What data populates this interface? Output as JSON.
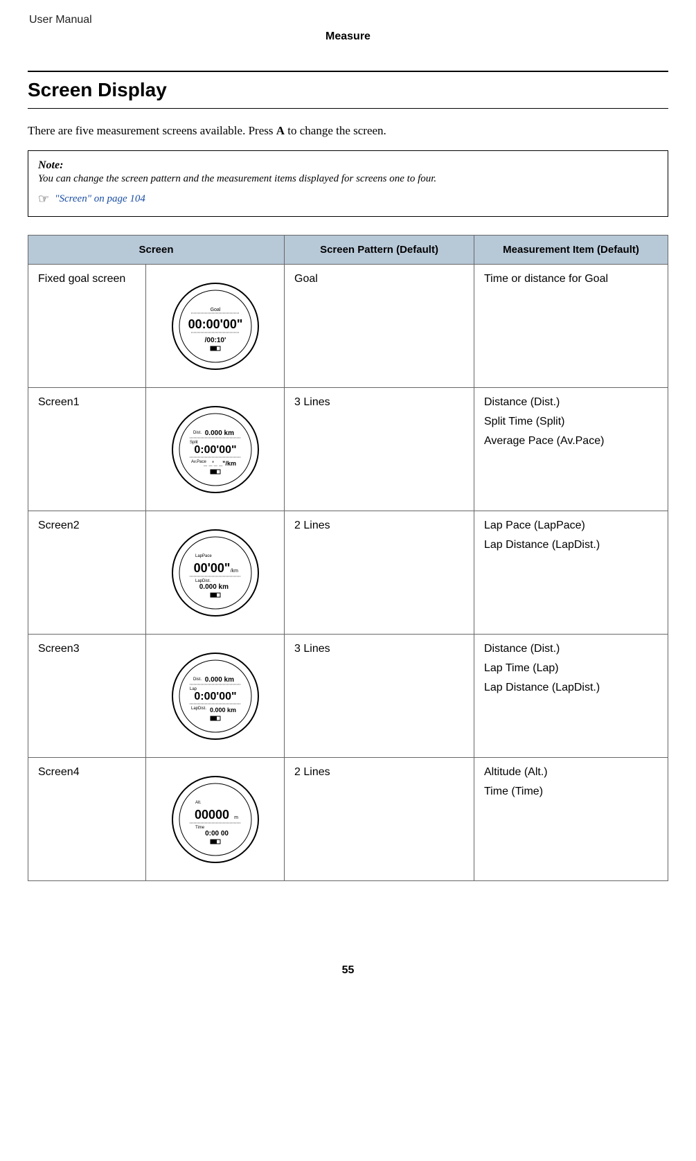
{
  "doc_header": "User Manual",
  "section_tag": "Measure",
  "page_title": "Screen Display",
  "intro_pre": "There are five measurement screens available. Press ",
  "intro_btn": "A",
  "intro_post": " to change the screen.",
  "note": {
    "title": "Note:",
    "text": "You can change the screen pattern and the measurement items displayed for screens one to four.",
    "link": "\"Screen\" on page 104"
  },
  "headers": {
    "screen": "Screen",
    "pattern": "Screen Pattern (Default)",
    "measure": "Measurement Item (Default)"
  },
  "rows": [
    {
      "label": "Fixed goal screen",
      "pattern": "Goal",
      "measure": [
        "Time or distance for Goal"
      ],
      "watch": {
        "type": "goal",
        "top": "Goal",
        "main": "00:00'00\"",
        "sub": "/00:10'"
      }
    },
    {
      "label": "Screen1",
      "pattern": "3 Lines",
      "measure": [
        "Distance (Dist.)",
        "Split Time (Split)",
        "Average Pace (Av.Pace)"
      ],
      "watch": {
        "type": "3line",
        "l1l": "Dist.",
        "l1": "0.000 km",
        "l2l": "Split",
        "l2": "0:00'00\"",
        "l3l": "Av.Pace",
        "l3": "_ _'_ _\"/km"
      }
    },
    {
      "label": "Screen2",
      "pattern": "2 Lines",
      "measure": [
        "Lap Pace (LapPace)",
        "Lap Distance (LapDist.)"
      ],
      "watch": {
        "type": "2line",
        "l1l": "LapPace",
        "l1": "00'00\"",
        "l1u": "/km",
        "l2l": "LapDist.",
        "l2": "0.000 km"
      }
    },
    {
      "label": "Screen3",
      "pattern": "3 Lines",
      "measure": [
        "Distance (Dist.)",
        "Lap Time (Lap)",
        "Lap Distance (LapDist.)"
      ],
      "watch": {
        "type": "3line",
        "l1l": "Dist.",
        "l1": "0.000 km",
        "l2l": "Lap",
        "l2": "0:00'00\"",
        "l3l": "LapDist.",
        "l3": "0.000 km"
      }
    },
    {
      "label": "Screen4",
      "pattern": "2 Lines",
      "measure": [
        "Altitude (Alt.)",
        "Time (Time)"
      ],
      "watch": {
        "type": "2line",
        "l1l": "Alt.",
        "l1": "00000",
        "l1u": "m",
        "l2l": "Time",
        "l2": "0:00 00"
      }
    }
  ],
  "page_num": "55"
}
